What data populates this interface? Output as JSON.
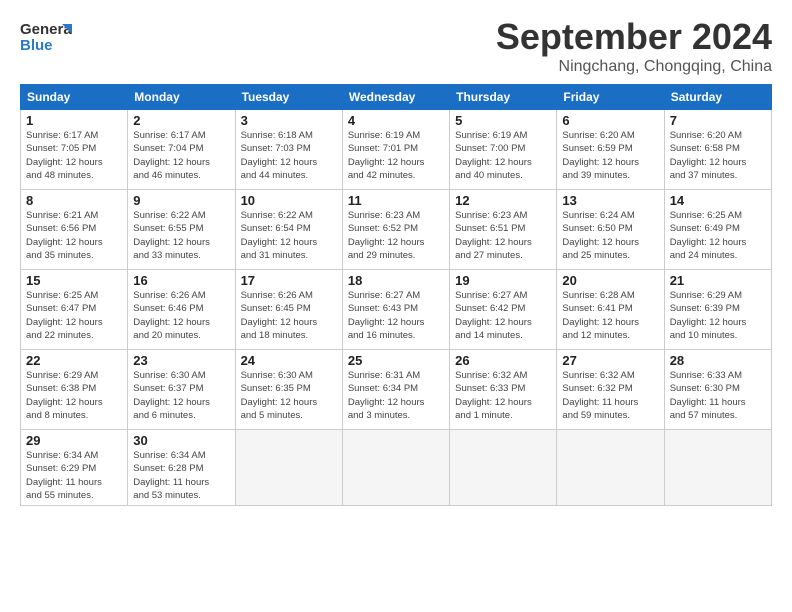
{
  "header": {
    "logo_line1": "General",
    "logo_line2": "Blue",
    "month": "September 2024",
    "location": "Ningchang, Chongqing, China"
  },
  "days_of_week": [
    "Sunday",
    "Monday",
    "Tuesday",
    "Wednesday",
    "Thursday",
    "Friday",
    "Saturday"
  ],
  "weeks": [
    [
      {
        "day": 1,
        "info": "Sunrise: 6:17 AM\nSunset: 7:05 PM\nDaylight: 12 hours\nand 48 minutes."
      },
      {
        "day": 2,
        "info": "Sunrise: 6:17 AM\nSunset: 7:04 PM\nDaylight: 12 hours\nand 46 minutes."
      },
      {
        "day": 3,
        "info": "Sunrise: 6:18 AM\nSunset: 7:03 PM\nDaylight: 12 hours\nand 44 minutes."
      },
      {
        "day": 4,
        "info": "Sunrise: 6:19 AM\nSunset: 7:01 PM\nDaylight: 12 hours\nand 42 minutes."
      },
      {
        "day": 5,
        "info": "Sunrise: 6:19 AM\nSunset: 7:00 PM\nDaylight: 12 hours\nand 40 minutes."
      },
      {
        "day": 6,
        "info": "Sunrise: 6:20 AM\nSunset: 6:59 PM\nDaylight: 12 hours\nand 39 minutes."
      },
      {
        "day": 7,
        "info": "Sunrise: 6:20 AM\nSunset: 6:58 PM\nDaylight: 12 hours\nand 37 minutes."
      }
    ],
    [
      {
        "day": 8,
        "info": "Sunrise: 6:21 AM\nSunset: 6:56 PM\nDaylight: 12 hours\nand 35 minutes."
      },
      {
        "day": 9,
        "info": "Sunrise: 6:22 AM\nSunset: 6:55 PM\nDaylight: 12 hours\nand 33 minutes."
      },
      {
        "day": 10,
        "info": "Sunrise: 6:22 AM\nSunset: 6:54 PM\nDaylight: 12 hours\nand 31 minutes."
      },
      {
        "day": 11,
        "info": "Sunrise: 6:23 AM\nSunset: 6:52 PM\nDaylight: 12 hours\nand 29 minutes."
      },
      {
        "day": 12,
        "info": "Sunrise: 6:23 AM\nSunset: 6:51 PM\nDaylight: 12 hours\nand 27 minutes."
      },
      {
        "day": 13,
        "info": "Sunrise: 6:24 AM\nSunset: 6:50 PM\nDaylight: 12 hours\nand 25 minutes."
      },
      {
        "day": 14,
        "info": "Sunrise: 6:25 AM\nSunset: 6:49 PM\nDaylight: 12 hours\nand 24 minutes."
      }
    ],
    [
      {
        "day": 15,
        "info": "Sunrise: 6:25 AM\nSunset: 6:47 PM\nDaylight: 12 hours\nand 22 minutes."
      },
      {
        "day": 16,
        "info": "Sunrise: 6:26 AM\nSunset: 6:46 PM\nDaylight: 12 hours\nand 20 minutes."
      },
      {
        "day": 17,
        "info": "Sunrise: 6:26 AM\nSunset: 6:45 PM\nDaylight: 12 hours\nand 18 minutes."
      },
      {
        "day": 18,
        "info": "Sunrise: 6:27 AM\nSunset: 6:43 PM\nDaylight: 12 hours\nand 16 minutes."
      },
      {
        "day": 19,
        "info": "Sunrise: 6:27 AM\nSunset: 6:42 PM\nDaylight: 12 hours\nand 14 minutes."
      },
      {
        "day": 20,
        "info": "Sunrise: 6:28 AM\nSunset: 6:41 PM\nDaylight: 12 hours\nand 12 minutes."
      },
      {
        "day": 21,
        "info": "Sunrise: 6:29 AM\nSunset: 6:39 PM\nDaylight: 12 hours\nand 10 minutes."
      }
    ],
    [
      {
        "day": 22,
        "info": "Sunrise: 6:29 AM\nSunset: 6:38 PM\nDaylight: 12 hours\nand 8 minutes."
      },
      {
        "day": 23,
        "info": "Sunrise: 6:30 AM\nSunset: 6:37 PM\nDaylight: 12 hours\nand 6 minutes."
      },
      {
        "day": 24,
        "info": "Sunrise: 6:30 AM\nSunset: 6:35 PM\nDaylight: 12 hours\nand 5 minutes."
      },
      {
        "day": 25,
        "info": "Sunrise: 6:31 AM\nSunset: 6:34 PM\nDaylight: 12 hours\nand 3 minutes."
      },
      {
        "day": 26,
        "info": "Sunrise: 6:32 AM\nSunset: 6:33 PM\nDaylight: 12 hours\nand 1 minute."
      },
      {
        "day": 27,
        "info": "Sunrise: 6:32 AM\nSunset: 6:32 PM\nDaylight: 11 hours\nand 59 minutes."
      },
      {
        "day": 28,
        "info": "Sunrise: 6:33 AM\nSunset: 6:30 PM\nDaylight: 11 hours\nand 57 minutes."
      }
    ],
    [
      {
        "day": 29,
        "info": "Sunrise: 6:34 AM\nSunset: 6:29 PM\nDaylight: 11 hours\nand 55 minutes."
      },
      {
        "day": 30,
        "info": "Sunrise: 6:34 AM\nSunset: 6:28 PM\nDaylight: 11 hours\nand 53 minutes."
      },
      null,
      null,
      null,
      null,
      null
    ]
  ]
}
